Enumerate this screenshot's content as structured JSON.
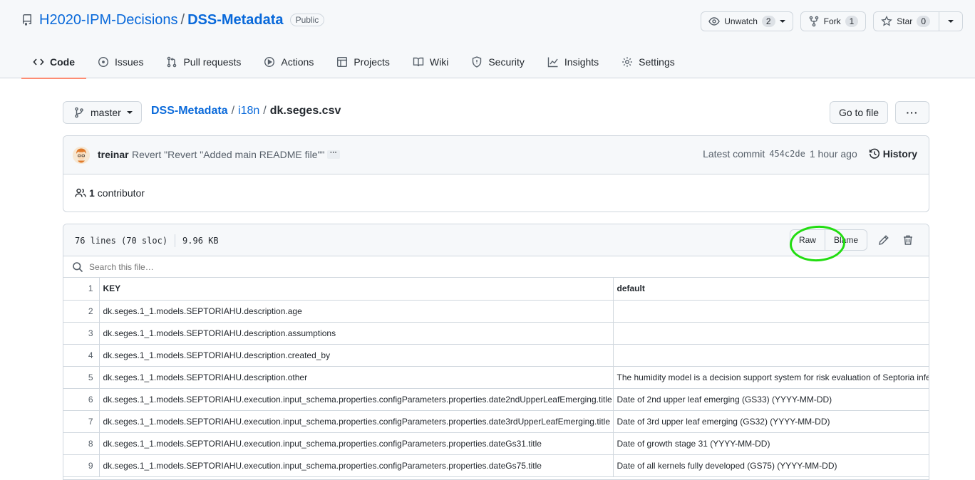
{
  "repo": {
    "owner": "H2020-IPM-Decisions",
    "name": "DSS-Metadata",
    "visibility": "Public",
    "unwatch_label": "Unwatch",
    "unwatch_count": "2",
    "fork_label": "Fork",
    "fork_count": "1",
    "star_label": "Star",
    "star_count": "0"
  },
  "tabs": [
    {
      "label": "Code",
      "icon": "code-icon"
    },
    {
      "label": "Issues",
      "icon": "issue-icon"
    },
    {
      "label": "Pull requests",
      "icon": "pull-request-icon"
    },
    {
      "label": "Actions",
      "icon": "play-icon"
    },
    {
      "label": "Projects",
      "icon": "table-icon"
    },
    {
      "label": "Wiki",
      "icon": "book-icon"
    },
    {
      "label": "Security",
      "icon": "shield-icon"
    },
    {
      "label": "Insights",
      "icon": "graph-icon"
    },
    {
      "label": "Settings",
      "icon": "gear-icon"
    }
  ],
  "breadcrumb": {
    "branch": "master",
    "root": "DSS-Metadata",
    "folder": "i18n",
    "file": "dk.seges.csv",
    "separator": "/",
    "goto_label": "Go to file",
    "more_label": "···"
  },
  "commit": {
    "author": "treinar",
    "message": "Revert \"Revert \"Added main README file\"\"",
    "ellipsis": "···",
    "latest_label": "Latest commit",
    "sha": "454c2de",
    "time": "1 hour ago",
    "history_label": "History",
    "contributors_count": "1",
    "contributors_label": "contributor"
  },
  "file": {
    "lines_info": "76 lines (70 sloc)",
    "size": "9.96 KB",
    "raw_label": "Raw",
    "blame_label": "Blame",
    "search_placeholder": "Search this file…"
  },
  "table": {
    "header": {
      "ln": "1",
      "key": "KEY",
      "default": "default"
    },
    "rows": [
      {
        "ln": "2",
        "key": "dk.seges.1_1.models.SEPTORIAHU.description.age",
        "default": ""
      },
      {
        "ln": "3",
        "key": "dk.seges.1_1.models.SEPTORIAHU.description.assumptions",
        "default": ""
      },
      {
        "ln": "4",
        "key": "dk.seges.1_1.models.SEPTORIAHU.description.created_by",
        "default": ""
      },
      {
        "ln": "5",
        "key": "dk.seges.1_1.models.SEPTORIAHU.description.other",
        "default": "The humidity model is a decision support system for risk evaluation of Septoria infe"
      },
      {
        "ln": "6",
        "key": "dk.seges.1_1.models.SEPTORIAHU.execution.input_schema.properties.configParameters.properties.date2ndUpperLeafEmerging.title",
        "default": "Date of 2nd upper leaf emerging (GS33) (YYYY-MM-DD)"
      },
      {
        "ln": "7",
        "key": "dk.seges.1_1.models.SEPTORIAHU.execution.input_schema.properties.configParameters.properties.date3rdUpperLeafEmerging.title",
        "default": "Date of 3rd upper leaf emerging (GS32) (YYYY-MM-DD)"
      },
      {
        "ln": "8",
        "key": "dk.seges.1_1.models.SEPTORIAHU.execution.input_schema.properties.configParameters.properties.dateGs31.title",
        "default": "Date of growth stage 31 (YYYY-MM-DD)"
      },
      {
        "ln": "9",
        "key": "dk.seges.1_1.models.SEPTORIAHU.execution.input_schema.properties.configParameters.properties.dateGs75.title",
        "default": "Date of all kernels fully developed (GS75) (YYYY-MM-DD)"
      }
    ]
  }
}
